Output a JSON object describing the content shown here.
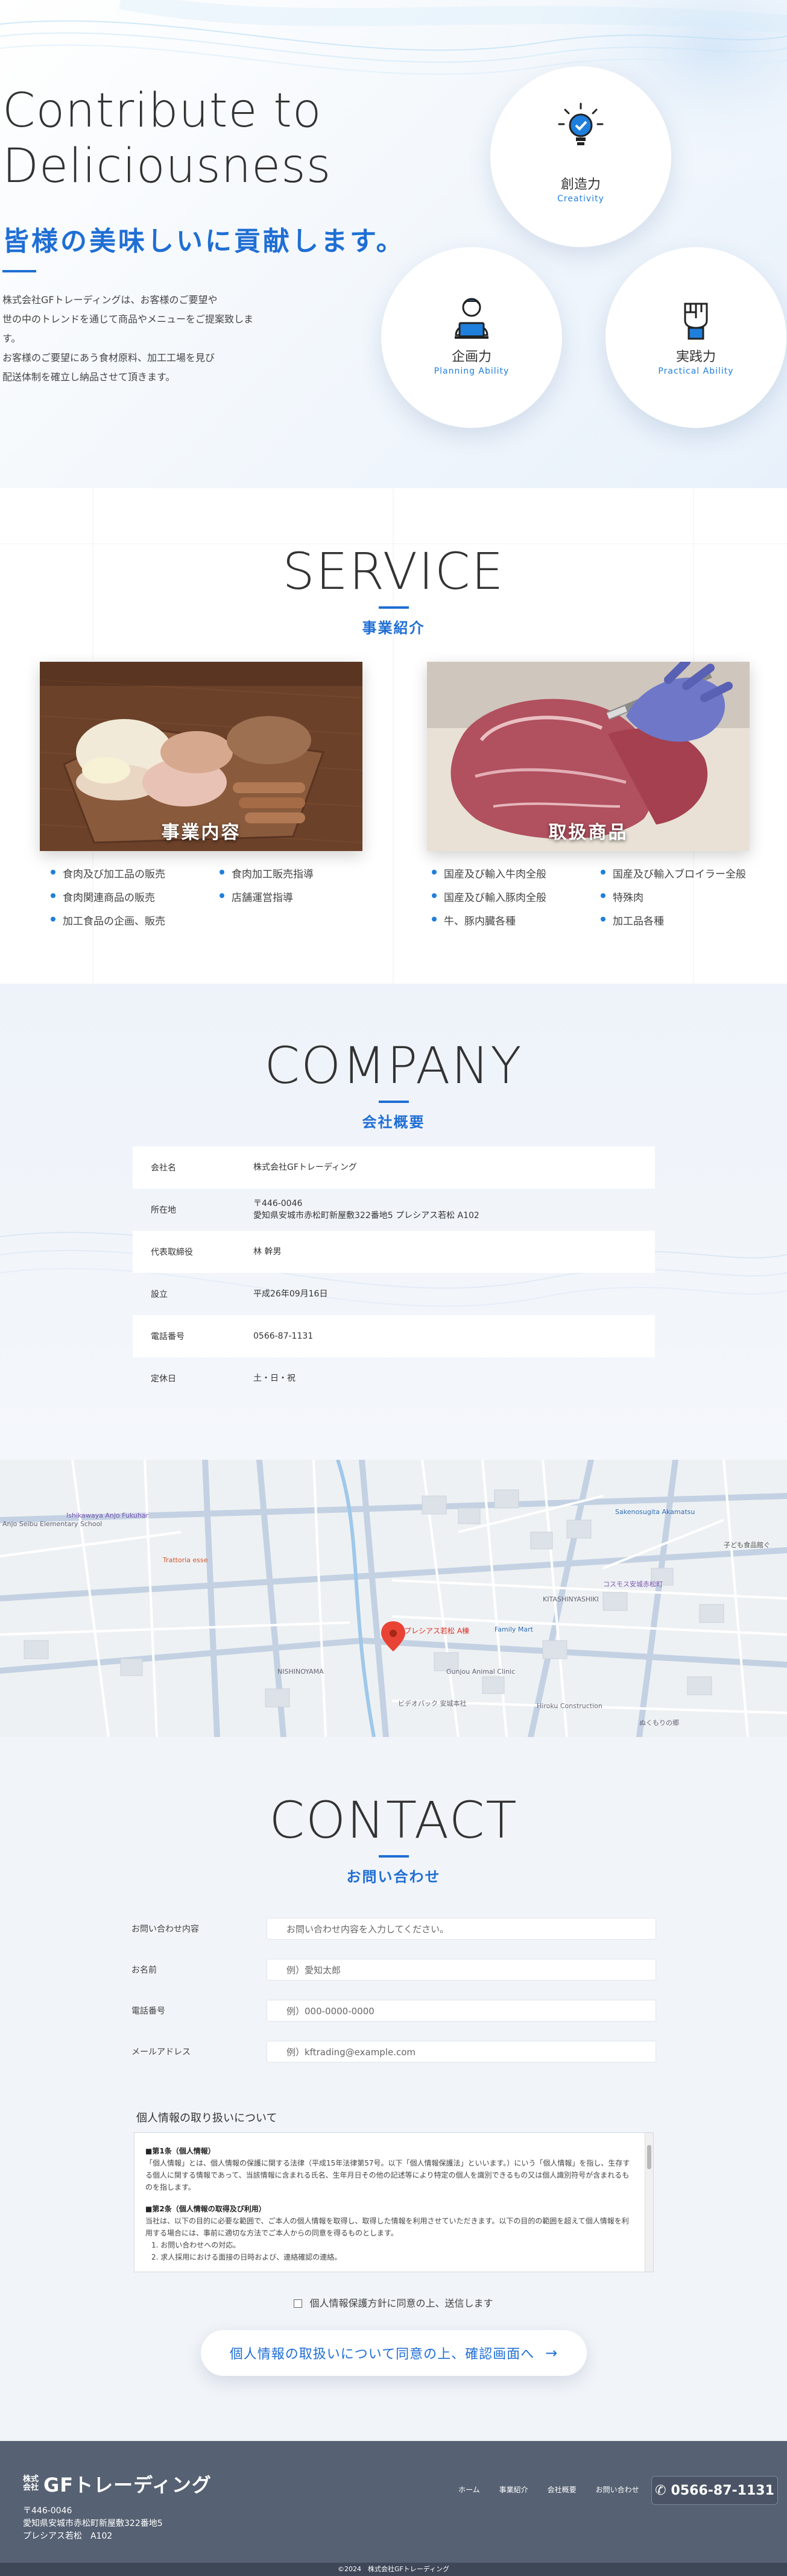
{
  "hero": {
    "title_line1": "Contribute to",
    "title_line2": "Deliciousness",
    "subtitle": "皆様の美味しいに貢献します。",
    "desc_lines": [
      "株式会社GFトレーディングは、お客様のご要望や",
      "世の中のトレンドを通じて商品やメニューをご提案致します。",
      "お客様のご要望にあう食材原料、加工工場を見び",
      "配送体制を確立し納品させて頂きます。"
    ],
    "abilities": [
      {
        "jp": "創造力",
        "en": "Creativity",
        "icon": "lightbulb-icon"
      },
      {
        "jp": "企画力",
        "en": "Planning Ability",
        "icon": "laptop-person-icon"
      },
      {
        "jp": "実践力",
        "en": "Practical Ability",
        "icon": "fist-icon"
      }
    ]
  },
  "service": {
    "title": "SERVICE",
    "subtitle": "事業紹介",
    "cards": [
      {
        "label": "事業内容",
        "items": [
          "食肉及び加工品の販売",
          "食肉加工販売指導",
          "食肉関連商品の販売",
          "店舗運営指導",
          "加工食品の企画、販売"
        ]
      },
      {
        "label": "取扱商品",
        "items": [
          "国産及び輸入牛肉全般",
          "国産及び輸入ブロイラー全般",
          "国産及び輸入豚肉全般",
          "特殊肉",
          "牛、豚内臓各種",
          "加工品各種"
        ]
      }
    ]
  },
  "company": {
    "title": "COMPANY",
    "subtitle": "会社概要",
    "rows": [
      {
        "k": "会社名",
        "v": "株式会社GFトレーディング"
      },
      {
        "k": "所在地",
        "v": "〒446-0046\n愛知県安城市赤松町新屋敷322番地5 プレシアス若松 A102"
      },
      {
        "k": "代表取締役",
        "v": "林 幹男"
      },
      {
        "k": "設立",
        "v": "平成26年09月16日"
      },
      {
        "k": "電話番号",
        "v": "0566-87-1131"
      },
      {
        "k": "定休日",
        "v": "土・日・祝"
      }
    ]
  },
  "map": {
    "marker_label": "プレシアス若松 A棟",
    "labels": [
      "Anjo Seibu Elementary School",
      "Ishikawaya Anjo Fukuhar",
      "Trattoria esse",
      "Sakenosugita Akamatsu",
      "子ども食品館ぐ",
      "コスモス安城赤松町",
      "KITASHINYASHIKI",
      "Family Mart",
      "NISHINOYAMA",
      "Gunjou Animal Clinic",
      "ビデオパック 安城本社",
      "Hiroku Construction",
      "ぬくもりの郷"
    ]
  },
  "contact": {
    "title": "CONTACT",
    "subtitle": "お問い合わせ",
    "fields": [
      {
        "label": "お問い合わせ内容",
        "placeholder": "お問い合わせ内容を入力してください。"
      },
      {
        "label": "お名前",
        "placeholder": "例）愛知太郎"
      },
      {
        "label": "電話番号",
        "placeholder": "例）000-0000-0000"
      },
      {
        "label": "メールアドレス",
        "placeholder": "例）kftrading@example.com"
      }
    ],
    "privacy_title": "個人情報の取り扱いについて",
    "privacy_h1": "■第1条（個人情報）",
    "privacy_p1": "「個人情報」とは、個人情報の保護に関する法律（平成15年法律第57号。以下「個人情報保護法」といいます。）にいう「個人情報」を指し、生存する個人に関する情報であって、当該情報に含まれる氏名、生年月日その他の記述等により特定の個人を識別できるもの又は個人識別符号が含まれるものを指します。",
    "privacy_h2": "■第2条（個人情報の取得及び利用）",
    "privacy_p2": "当社は、以下の目的に必要な範囲で、ご本人の個人情報を取得し、取得した情報を利用させていただきます。以下の目的の範囲を超えて個人情報を利用する場合には、事前に適切な方法でご本人からの同意を得るものとします。",
    "privacy_li": [
      "1. お問い合わせへの対応。",
      "2. 求人採用における面接の日時および、連絡確認の連絡。"
    ],
    "agree": "個人情報保護方針に同意の上、送信します",
    "confirm": "個人情報の取扱いについて同意の上、確認画面へ"
  },
  "footer": {
    "corp": "株式会社",
    "name": "GFトレーディング",
    "addr1": "〒446-0046",
    "addr2": "愛知県安城市赤松町新屋敷322番地5",
    "addr3": "プレシアス若松　A102",
    "nav": [
      "ホーム",
      "事業紹介",
      "会社概要",
      "お問い合わせ"
    ],
    "tel": "0566-87-1131",
    "copyright": "©2024　株式会社GFトレーディング"
  },
  "colors": {
    "accent": "#1f6ed4",
    "footer": "#566173"
  }
}
